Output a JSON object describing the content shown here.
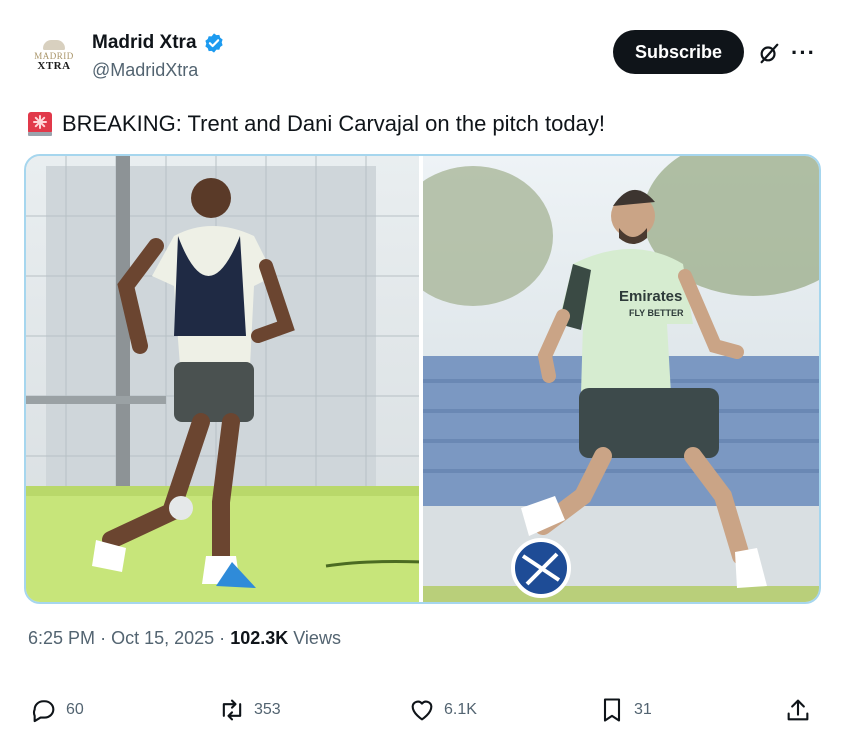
{
  "author": {
    "display_name": "Madrid Xtra",
    "handle": "@MadridXtra",
    "avatar_text_top": "MADRID",
    "avatar_text_bottom": "XTRA",
    "verified": true,
    "verified_color": "#1d9bf0"
  },
  "header": {
    "subscribe_label": "Subscribe",
    "more_label": "···"
  },
  "tweet": {
    "emoji_icon": "rotating-light-icon",
    "text": "BREAKING: Trent and Dani Carvajal on the pitch today!"
  },
  "media": {
    "images": [
      {
        "subject": "player-training-left"
      },
      {
        "subject": "player-training-right",
        "shirt_text": "Emirates",
        "shirt_subtext": "FLY BETTER"
      }
    ],
    "border_color": "#a6d6ee"
  },
  "meta": {
    "time": "6:25 PM",
    "separator": "·",
    "date": "Oct 15, 2025",
    "views_count": "102.3K",
    "views_label": "Views"
  },
  "actions": {
    "replies": "60",
    "reposts": "353",
    "likes": "6.1K",
    "bookmarks": "31"
  }
}
